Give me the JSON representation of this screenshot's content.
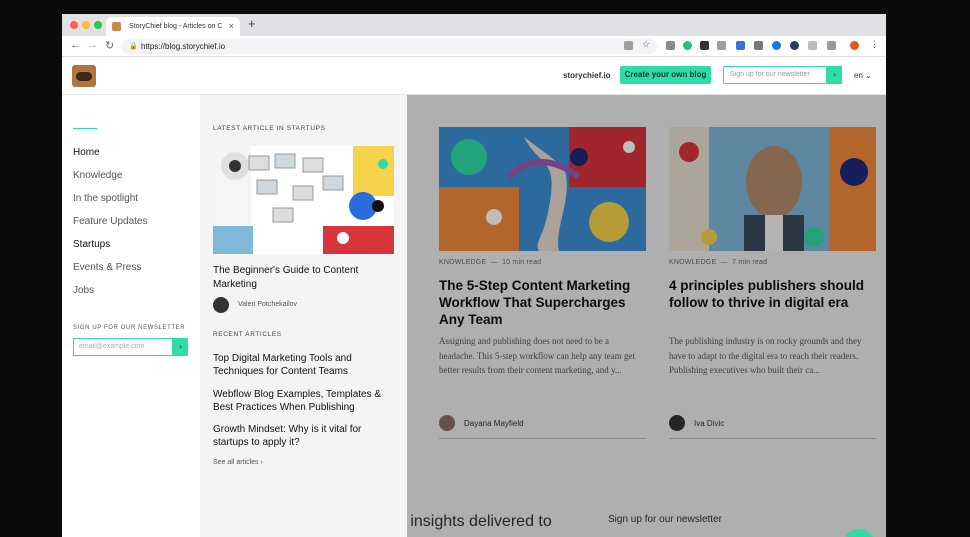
{
  "browser": {
    "tab_title": "StoryChief blog - Articles on C",
    "tab_close": "×",
    "new_tab": "+",
    "back": "←",
    "forward": "→",
    "reload": "↻",
    "lock": "🔒",
    "url": "https://blog.storychief.io",
    "traffic_colors": [
      "#ff5f57",
      "#febc2e",
      "#28c840"
    ]
  },
  "header": {
    "link": "storychief.io",
    "cta": "Create your own blog",
    "newsletter_placeholder": "Sign up for our newsletter",
    "newsletter_submit": "›",
    "language": "en ⌄"
  },
  "sidebar": {
    "items": [
      "Home",
      "Knowledge",
      "In the spotlight",
      "Feature Updates",
      "Startups",
      "Events & Press",
      "Jobs"
    ],
    "newsletter_label": "SIGN UP FOR OUR NEWSLETTER",
    "newsletter_placeholder": "email@example.com",
    "newsletter_submit": "›"
  },
  "panel": {
    "latest_label": "LATEST ARTICLE IN STARTUPS",
    "latest_title": "The Beginner's Guide to Content Marketing",
    "latest_author": "Valeri Potchekailov",
    "recent_label": "RECENT ARTICLES",
    "recent": [
      "Top Digital Marketing Tools and Techniques for Content Teams",
      "Webflow Blog Examples, Templates & Best Practices When Publishing",
      "Growth Mindset: Why is it vital for startups to apply it?"
    ],
    "see_all": "See all articles ›"
  },
  "cards": [
    {
      "category": "KNOWLEDGE",
      "read_time": "10 min read",
      "title": "The 5-Step Content Marketing Workflow That Supercharges Any Team",
      "excerpt": "Assigning and publishing does not need to be a headache. This 5-step workflow can help any team get better results from their content marketing, and y...",
      "author": "Dayana Mayfield"
    },
    {
      "category": "KNOWLEDGE",
      "read_time": "7 min read",
      "title": "4 principles publishers should follow to thrive in digital era",
      "excerpt": "The publishing industry is on rocky grounds and they have to adapt to the digital era to reach their readers. Publishing executives who built their ca...",
      "author": "Iva Divic"
    }
  ],
  "footer": {
    "insights_text": "g insights delivered to",
    "newsletter_text": "Sign up for our newsletter"
  },
  "colors": {
    "accent": "#2fdca8",
    "overlay": "rgba(0,0,0,0.26)"
  }
}
